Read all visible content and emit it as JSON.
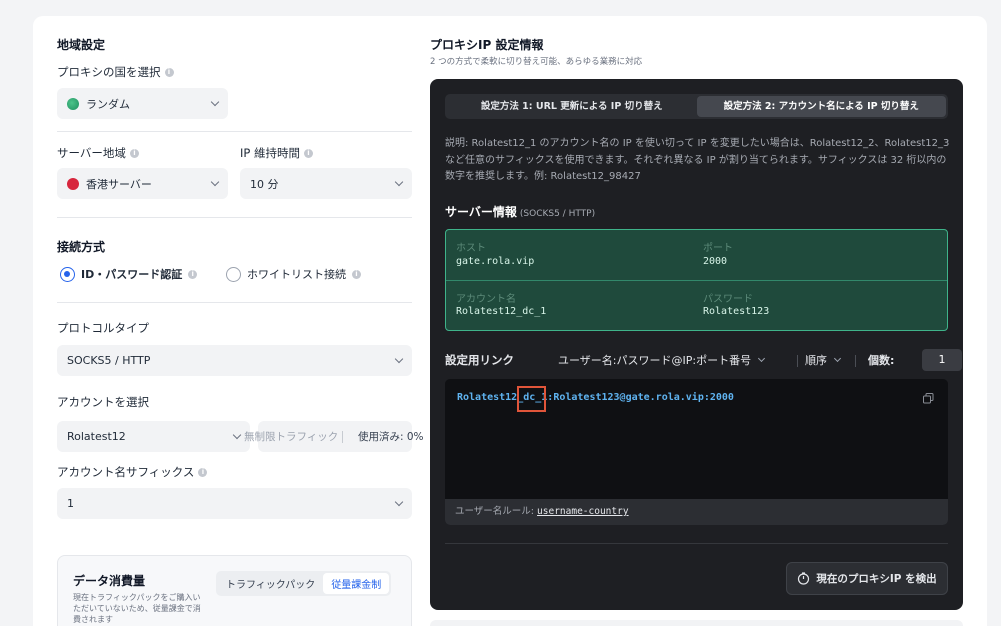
{
  "region": {
    "title": "地域設定",
    "country_label": "プロキシの国を選択",
    "country_value": "ランダム",
    "server_label": "サーバー地域",
    "server_value": "香港サーバー",
    "ip_keep_label": "IP 維持時間",
    "ip_keep_value": "10 分"
  },
  "connection": {
    "title": "接続方式",
    "option_id": "ID・パスワード認証",
    "option_whitelist": "ホワイトリスト接続",
    "protocol_label": "プロトコルタイプ",
    "protocol_value": "SOCKS5 / HTTP",
    "account_label": "アカウントを選択",
    "account_value": "Rolatest12",
    "traffic_text": "無制限トラフィック",
    "used_text": "使用済み: 0%",
    "suffix_label": "アカウント名サフィックス",
    "suffix_value": "1"
  },
  "usage": {
    "title": "データ消費量",
    "desc": "現在トラフィックパックをご購入いただいていないため、従量課金で消費されます",
    "seg_traffic": "トラフィックパック",
    "seg_payg": "従量課金制"
  },
  "proxy": {
    "title": "プロキシIP 設定情報",
    "subtitle": "2 つの方式で柔軟に切り替え可能、あらゆる業務に対応",
    "tab1": "設定方法 1: URL 更新による IP 切り替え",
    "tab2": "設定方法 2: アカウント名による IP 切り替え",
    "description": "説明: Rolatest12_1 のアカウント名の IP を使い切って IP を変更したい場合は、Rolatest12_2、Rolatest12_3 など任意のサフィックスを使用できます。それぞれ異なる IP が割り当てられます。サフィックスは 32 桁以内の数字を推奨します。例: Rolatest12_98427",
    "server_info_title": "サーバー情報",
    "server_info_sub": "(SOCKS5 / HTTP)",
    "host_label": "ホスト",
    "host_value": "gate.rola.vip",
    "port_label": "ポート",
    "port_value": "2000",
    "account_label": "アカウント名",
    "account_value": "Rolatest12_dc_1",
    "password_label": "パスワード",
    "password_value": "Rolatest123",
    "link_title": "設定用リンク",
    "format_value": "ユーザー名:パスワード@IP:ポート番号",
    "order_label": "順序",
    "count_label": "個数:",
    "count_value": "1",
    "link_text": "Rolatest12_dc_1:Rolatest123@gate.rola.vip:2000",
    "rule_label": "ユーザー名ルール:",
    "rule_value": "username-country",
    "detect_button": "現在のプロキシIP を検出"
  }
}
